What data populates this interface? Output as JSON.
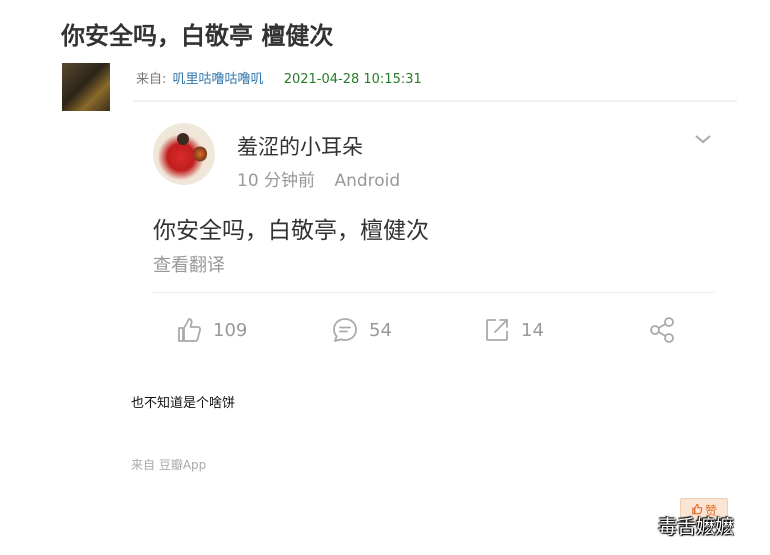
{
  "article": {
    "title": "你安全吗，白敬亭 檀健次",
    "meta_prefix": "来自:",
    "author": "叽里咕噜咕噜叽",
    "timestamp": "2021-04-28 10:15:31"
  },
  "post": {
    "username": "羞涩的小耳朵",
    "time_ago": "10 分钟前",
    "source": "Android",
    "text": "你安全吗，白敬亭，檀健次",
    "translate_label": "查看翻译",
    "likes": "109",
    "comments": "54",
    "reposts": "14"
  },
  "body_text": "也不知道是个啥饼",
  "source_line": "来自 豆瓣App",
  "like_button_label": "赞",
  "watermark": "毒舌嬷嬷"
}
